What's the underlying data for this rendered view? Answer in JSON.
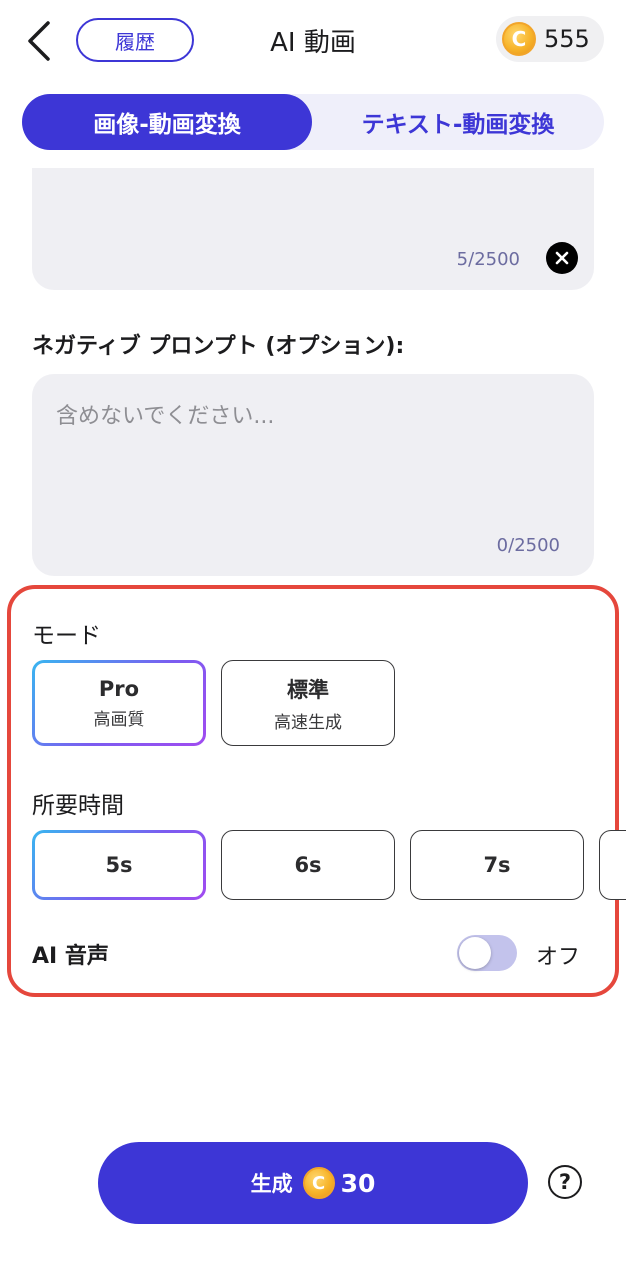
{
  "header": {
    "back_icon": "chevron-left-icon",
    "history_label": "履歴",
    "title": "AI 動画",
    "coin_icon": "coin-icon",
    "coin_symbol": "C",
    "coin_balance": "555"
  },
  "tabs": [
    {
      "label": "画像-動画変換",
      "selected": true
    },
    {
      "label": "テキスト-動画変換",
      "selected": false
    }
  ],
  "prompt": {
    "count": "5/2500",
    "clear_icon": "close-icon"
  },
  "negative_prompt": {
    "label": "ネガティブ プロンプト (オプション):",
    "placeholder": "含めないでください...",
    "value": "",
    "count": "0/2500"
  },
  "settings": {
    "mode_label": "モード",
    "modes": [
      {
        "title": "Pro",
        "subtitle": "高画質",
        "selected": true
      },
      {
        "title": "標準",
        "subtitle": "高速生成",
        "selected": false
      }
    ],
    "duration_label": "所要時間",
    "durations": [
      {
        "label": "5s",
        "selected": true
      },
      {
        "label": "6s",
        "selected": false
      },
      {
        "label": "7s",
        "selected": false
      }
    ],
    "ai_voice_label": "AI 音声",
    "ai_voice_state": "オフ",
    "ai_voice_on": false
  },
  "footer": {
    "generate_label": "生成",
    "coin_symbol": "C",
    "generate_cost": "30",
    "help_icon": "question-circle-icon",
    "help_symbol": "?"
  },
  "colors": {
    "accent": "#3d36d6",
    "highlight_border": "#e5473c",
    "coin": "#f7b42a",
    "input_bg": "#efeff3"
  }
}
